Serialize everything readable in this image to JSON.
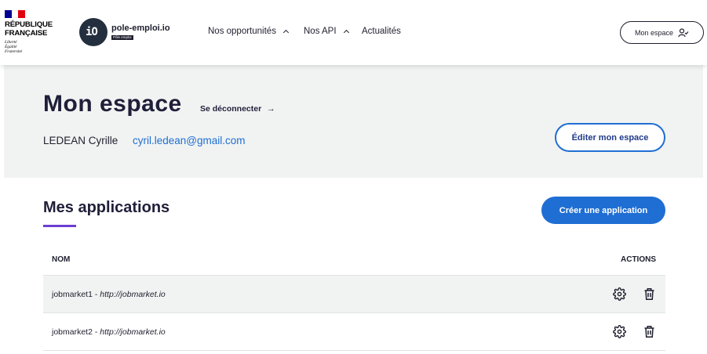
{
  "header": {
    "gov_logo_lines": [
      "République",
      "Française"
    ],
    "gov_motto": [
      "Liberté",
      "Égalité",
      "Fraternité"
    ],
    "brand_glyph": "iO",
    "brand_name": "pole-emploi.io",
    "brand_badge": "Pôle emploi",
    "nav": [
      {
        "label": "Nos opportunités",
        "icon": "chevron-up-icon"
      },
      {
        "label": "Nos API",
        "icon": "chevron-up-icon"
      },
      {
        "label": "Actualités"
      }
    ],
    "account_button": {
      "label": "Mon espace",
      "icon": "user-check-icon"
    }
  },
  "hero": {
    "title": "Mon espace",
    "logout_label": "Se déconnecter",
    "logout_icon": "arrow-right-icon",
    "user_name": "LEDEAN Cyrille",
    "user_email": "cyril.ledean@gmail.com",
    "edit_button": "Éditer mon espace"
  },
  "apps": {
    "title": "Mes applications",
    "create_button": "Créer une application",
    "columns": {
      "name": "NOM",
      "actions": "ACTIONS"
    },
    "rows": [
      {
        "name": "jobmarket1",
        "sep": " - ",
        "url": "http://jobmarket.io",
        "icons": [
          "gear-icon",
          "trash-icon"
        ]
      },
      {
        "name": "jobmarket2",
        "sep": " - ",
        "url": "http://jobmarket.io",
        "icons": [
          "gear-icon",
          "trash-icon"
        ]
      }
    ]
  },
  "colors": {
    "primary": "#1f6ed3",
    "accent_underline": "#6b3fd4",
    "hero_bg": "#f1f3f2"
  }
}
